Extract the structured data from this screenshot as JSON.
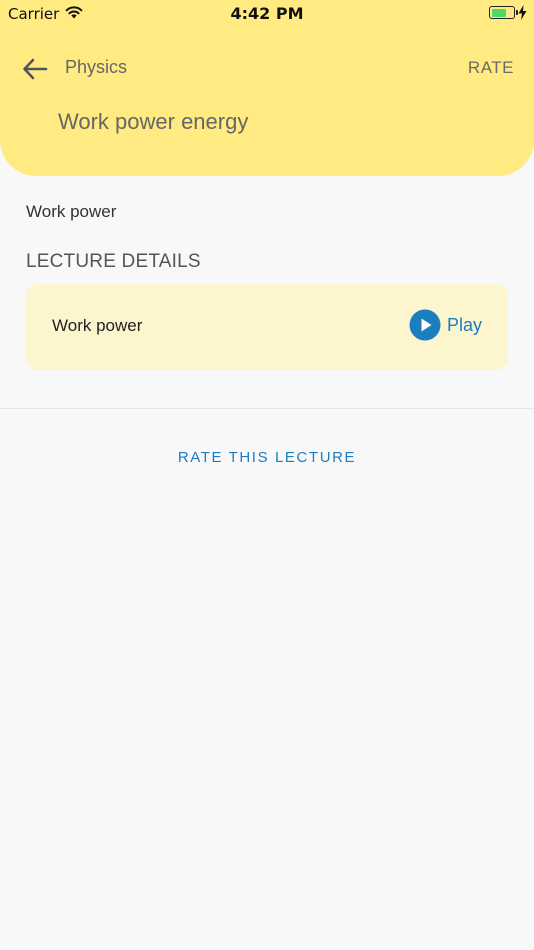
{
  "status_bar": {
    "carrier": "Carrier",
    "time": "4:42 PM",
    "battery_level": 0.7,
    "battery_color": "#4cd964"
  },
  "header": {
    "background": "#ffeb82",
    "back_icon": "arrow-left-icon",
    "subject": "Physics",
    "rate_label": "RATE",
    "title": "Work power energy"
  },
  "lecture": {
    "name": "Work power",
    "section_heading": "LECTURE DETAILS",
    "card": {
      "background": "#fcf5ce",
      "title": "Work power",
      "play_label": "Play",
      "play_icon": "play-circle-icon"
    }
  },
  "footer": {
    "rate_lecture_label": "RATE THIS LECTURE"
  },
  "colors": {
    "accent": "#1a7ebf",
    "page_background": "#f8f8f8",
    "text_muted": "#666666"
  }
}
